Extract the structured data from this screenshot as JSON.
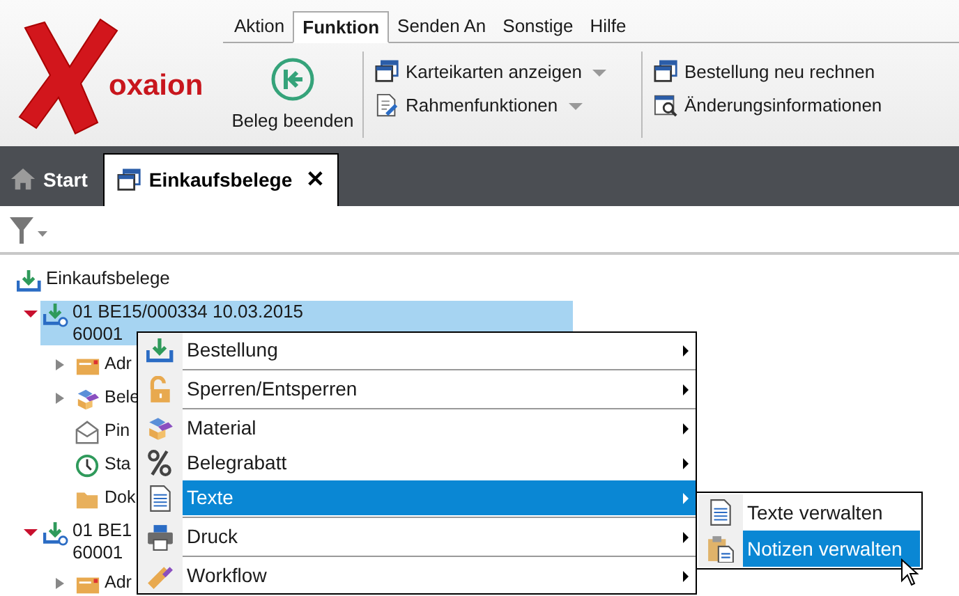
{
  "logo": {
    "text": "oxaion"
  },
  "ribbon_tabs": [
    {
      "label": "Aktion",
      "selected": false
    },
    {
      "label": "Funktion",
      "selected": true
    },
    {
      "label": "Senden An",
      "selected": false
    },
    {
      "label": "Sonstige",
      "selected": false
    },
    {
      "label": "Hilfe",
      "selected": false
    }
  ],
  "ribbon_big_button": {
    "label": "Beleg beenden"
  },
  "ribbon_groups": [
    [
      {
        "label": "Karteikarten anzeigen",
        "kind": "windows",
        "dropdown": true
      },
      {
        "label": "Rahmenfunktionen",
        "kind": "edit",
        "dropdown": true
      }
    ],
    [
      {
        "label": "Bestellung neu rechnen",
        "kind": "windows",
        "dropdown": false
      },
      {
        "label": "Änderungsinformationen",
        "kind": "search",
        "dropdown": false
      }
    ]
  ],
  "doc_tabs": [
    {
      "label": "Start",
      "kind": "home",
      "selected": false,
      "closable": false
    },
    {
      "label": "Einkaufsbelege",
      "kind": "windows",
      "selected": true,
      "closable": true
    }
  ],
  "close_glyph": "✕",
  "tree": [
    {
      "lines": [
        "Einkaufsbelege"
      ],
      "kind": "download",
      "selected": false,
      "children": [
        {
          "lines": [
            "01 BE15/000334 10.03.2015",
            "60001"
          ],
          "kind": "download-lock",
          "selected": true,
          "expanded": true,
          "children": [
            {
              "lines": [
                "Adr"
              ],
              "kind": "card",
              "selected": false,
              "expanded": false
            },
            {
              "lines": [
                "Bele"
              ],
              "kind": "boxes",
              "selected": false,
              "expanded": false
            },
            {
              "lines": [
                "Pin"
              ],
              "kind": "envelope",
              "selected": false
            },
            {
              "lines": [
                "Sta"
              ],
              "kind": "clock",
              "selected": false
            },
            {
              "lines": [
                "Dok"
              ],
              "kind": "folder",
              "selected": false
            }
          ]
        },
        {
          "lines": [
            "01 BE1",
            "60001"
          ],
          "kind": "download-lock",
          "selected": false,
          "expanded": true,
          "children": [
            {
              "lines": [
                "Adr"
              ],
              "kind": "card",
              "selected": false,
              "expanded": false
            }
          ]
        }
      ]
    }
  ],
  "context_menu": [
    {
      "label": "Bestellung",
      "kind": "download",
      "selected": false,
      "separator_after": true
    },
    {
      "label": "Sperren/Entsperren",
      "kind": "lock",
      "selected": false,
      "separator_after": true
    },
    {
      "label": "Material",
      "kind": "boxes",
      "selected": false,
      "separator_after": false
    },
    {
      "label": "Belegrabatt",
      "kind": "percent",
      "selected": false,
      "separator_after": false
    },
    {
      "label": "Texte",
      "kind": "document",
      "selected": true,
      "separator_after": true
    },
    {
      "label": "Druck",
      "kind": "printer",
      "selected": false,
      "separator_after": true
    },
    {
      "label": "Workflow",
      "kind": "pen",
      "selected": false,
      "separator_after": false
    }
  ],
  "submenu": [
    {
      "label": "Texte verwalten",
      "kind": "document",
      "selected": false
    },
    {
      "label": "Notizen verwalten",
      "kind": "clipboard",
      "selected": true
    }
  ]
}
